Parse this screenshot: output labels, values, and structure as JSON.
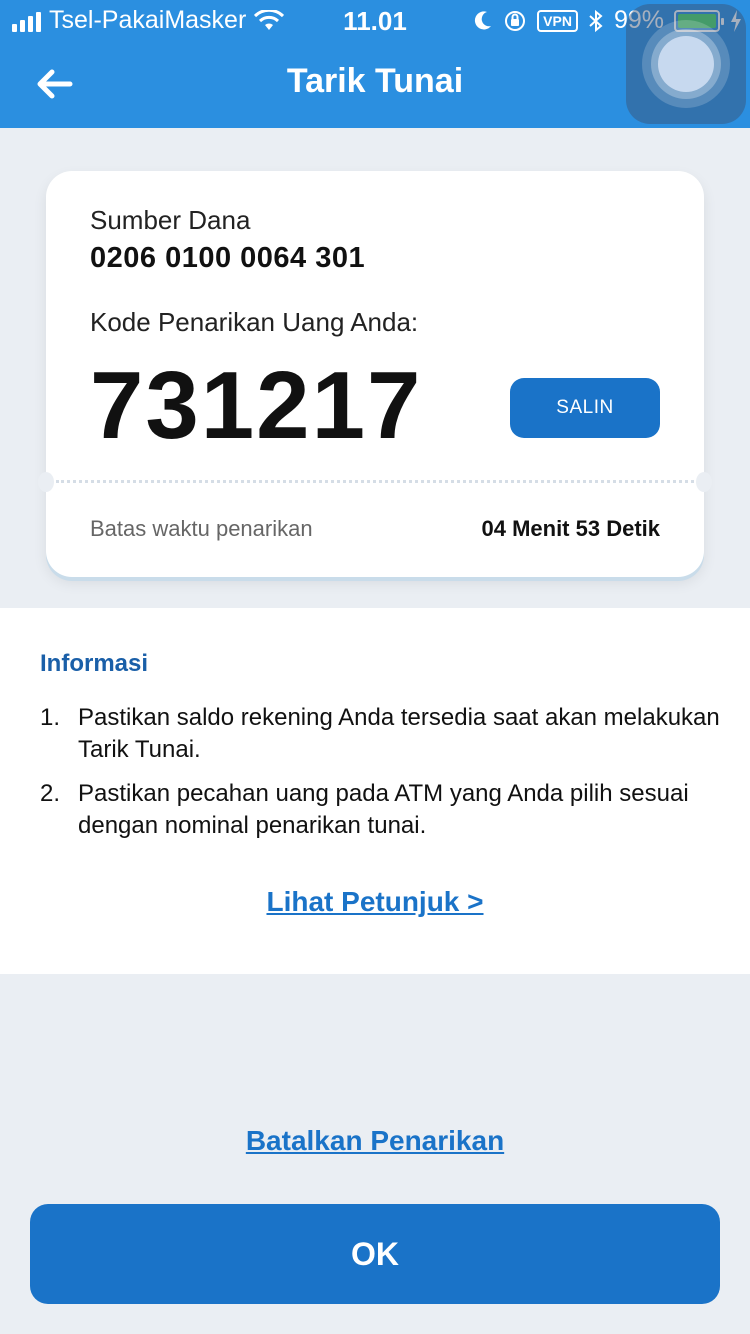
{
  "status_bar": {
    "carrier": "Tsel-PakaiMasker",
    "time": "11.01",
    "vpn": "VPN",
    "battery": "99%",
    "battery_level": 0.99
  },
  "header": {
    "title": "Tarik Tunai",
    "back_icon": "arrow-left-icon",
    "color": "#2b8fe0"
  },
  "card": {
    "source_label": "Sumber Dana",
    "source_value": "0206 0100 0064 301",
    "code_label": "Kode Penarikan Uang Anda:",
    "code_value": "731217",
    "copy_label": "SALIN",
    "time_label": "Batas waktu penarikan",
    "time_value": "04 Menit 53 Detik"
  },
  "info": {
    "title": "Informasi",
    "items": [
      {
        "num": "1.",
        "text": "Pastikan saldo rekening Anda tersedia saat akan melakukan Tarik Tunai."
      },
      {
        "num": "2.",
        "text": "Pastikan pecahan uang pada ATM yang Anda pilih sesuai dengan nominal penarikan tunai."
      }
    ],
    "link": "Lihat Petunjuk >"
  },
  "footer": {
    "cancel_link": "Batalkan Penarikan",
    "ok_label": "OK",
    "accent": "#1a73c8"
  }
}
